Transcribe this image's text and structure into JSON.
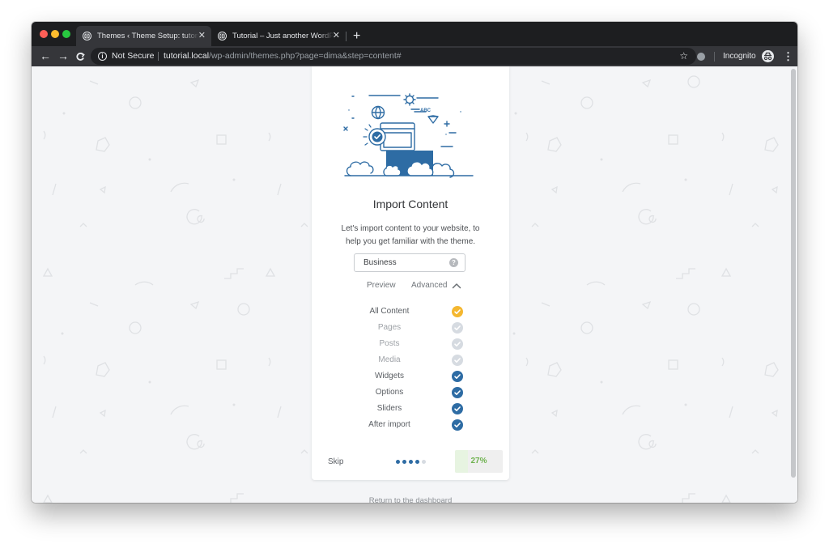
{
  "browser": {
    "tabs": [
      {
        "title": "Themes ‹ Theme Setup: tutorial",
        "active": true
      },
      {
        "title": "Tutorial – Just another WordPress site",
        "active": false
      }
    ],
    "omnibox": {
      "security": "Not Secure",
      "url_host": "tutorial.local",
      "url_path": "/wp-admin/themes.php?page=dima&step=content#"
    },
    "profile_label": "Incognito"
  },
  "card": {
    "illustration_text": "ABC",
    "title": "Import Content",
    "description": "Let's import content to your website, to help you get familiar with the theme.",
    "demo_select": {
      "value": "Business",
      "help": "?"
    },
    "preview_label": "Preview",
    "advanced_label": "Advanced",
    "options": [
      {
        "label": "All Content",
        "state": "partial"
      },
      {
        "label": "Pages",
        "state": "unchecked"
      },
      {
        "label": "Posts",
        "state": "unchecked"
      },
      {
        "label": "Media",
        "state": "unchecked"
      },
      {
        "label": "Widgets",
        "state": "checked"
      },
      {
        "label": "Options",
        "state": "checked"
      },
      {
        "label": "Sliders",
        "state": "checked"
      },
      {
        "label": "After import",
        "state": "checked"
      }
    ],
    "footer": {
      "skip_label": "Skip",
      "steps_total": 5,
      "steps_done": 4,
      "progress_label": "27%",
      "progress_value": 27
    }
  },
  "return_link": "Return to the dashboard",
  "colors": {
    "accent_blue": "#2e6ca4",
    "check_yellow": "#f4b730",
    "check_disabled": "#d6dbe1",
    "progress_green": "#6fb24f",
    "page_bg": "#f4f5f7",
    "chrome_dark": "#35363a"
  }
}
